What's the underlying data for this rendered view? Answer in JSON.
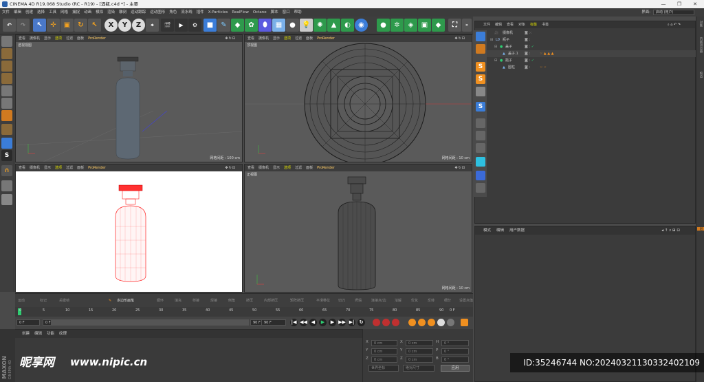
{
  "window": {
    "title": "CINEMA 4D R19.068 Studio (RC - R19) - [酒瓶.c4d *] - 主要",
    "min": "—",
    "max": "❐",
    "close": "✕"
  },
  "menu": {
    "items": [
      "文件",
      "编辑",
      "创建",
      "选择",
      "工具",
      "网格",
      "捕捉",
      "动画",
      "模拟",
      "渲染",
      "雕刻",
      "运动跟踪",
      "运动图形",
      "角色",
      "流水线",
      "插件",
      "X-Particles",
      "RealFlow",
      "Octane",
      "脚本",
      "窗口",
      "帮助"
    ],
    "layout_label": "界面:",
    "layout_value": "启动 (用户)"
  },
  "viewports": [
    {
      "menu": [
        "查看",
        "摄像机",
        "显示",
        "选项",
        "过滤",
        "面板",
        "ProRender"
      ],
      "label": "透视视图",
      "grid": "网格间距 : 100 cm"
    },
    {
      "menu": [
        "查看",
        "摄像机",
        "显示",
        "选项",
        "过滤",
        "面板",
        "ProRender"
      ],
      "label": "顶视图",
      "grid": "网格间距 : 10 cm"
    },
    {
      "menu": [
        "查看",
        "摄像机",
        "显示",
        "选项",
        "过滤",
        "面板",
        "ProRender"
      ],
      "label": "",
      "grid": ""
    },
    {
      "menu": [
        "查看",
        "摄像机",
        "显示",
        "选项",
        "过滤",
        "面板",
        "ProRender"
      ],
      "label": "正视图",
      "grid": "网格间距 : 10 cm"
    }
  ],
  "viewport_nav": "✥↻⊡",
  "object_manager": {
    "tabs": [
      "文件",
      "编辑",
      "查看",
      "对象",
      "标签",
      "书签"
    ],
    "rows": [
      {
        "name": "摄像机",
        "indent": 0
      },
      {
        "name": "瓶子",
        "indent": 0
      },
      {
        "name": "盖子",
        "indent": 1
      },
      {
        "name": "盖子.1",
        "indent": 2
      },
      {
        "name": "瓶子",
        "indent": 1
      },
      {
        "name": "圆柱",
        "indent": 2
      }
    ]
  },
  "attribute_manager": {
    "tabs": [
      "模式",
      "编辑",
      "用户数据"
    ]
  },
  "right_vtabs": [
    "对象",
    "内容浏览器",
    "构造",
    "层"
  ],
  "anim_bar": [
    "运动",
    "标记",
    "关键帧",
    "多边形画笔",
    "循环",
    "填充",
    "桥接",
    "焊接",
    "倒角",
    "挤压",
    "内部挤压",
    "矩阵挤压",
    "平滑移位",
    "切刀",
    "坍塌",
    "连接点/边",
    "溶解",
    "优化",
    "反转",
    "细分",
    "设置点值"
  ],
  "anim_hl": "多边形画笔",
  "timeline": {
    "ticks": [
      "0",
      "5",
      "10",
      "15",
      "20",
      "25",
      "30",
      "35",
      "40",
      "45",
      "50",
      "55",
      "60",
      "65",
      "70",
      "75",
      "80",
      "85",
      "90"
    ],
    "current": "0 F"
  },
  "playback": {
    "start": "0 F",
    "pos": "0 F",
    "range_end": "90 F",
    "end": "90 F"
  },
  "material_tabs": [
    "创建",
    "编辑",
    "功能",
    "纹理"
  ],
  "coords": {
    "rows": [
      {
        "axis": "X",
        "pos": "0 cm",
        "axis2": "X",
        "size": "0 cm",
        "axis3": "H",
        "rot": "0 °"
      },
      {
        "axis": "Y",
        "pos": "0 cm",
        "axis2": "Y",
        "size": "0 cm",
        "axis3": "P",
        "rot": "0 °"
      },
      {
        "axis": "Z",
        "pos": "0 cm",
        "axis2": "Z",
        "size": "0 cm",
        "axis3": "B",
        "rot": "0 °"
      }
    ],
    "sel1": "世界坐标",
    "sel2": "绝对尺寸",
    "apply": "应用"
  },
  "branding": {
    "maxon": "MAXON",
    "c4d": "CINEMA 4D"
  },
  "watermark": {
    "logo": "昵享网",
    "url": "www.nipic.cn",
    "id": "ID:35246744 NO:20240321130332402109"
  },
  "colors": {
    "accent": "#3b7dd8",
    "orange": "#f09020",
    "green": "#2ecc71",
    "red_wire": "#ff2020"
  }
}
